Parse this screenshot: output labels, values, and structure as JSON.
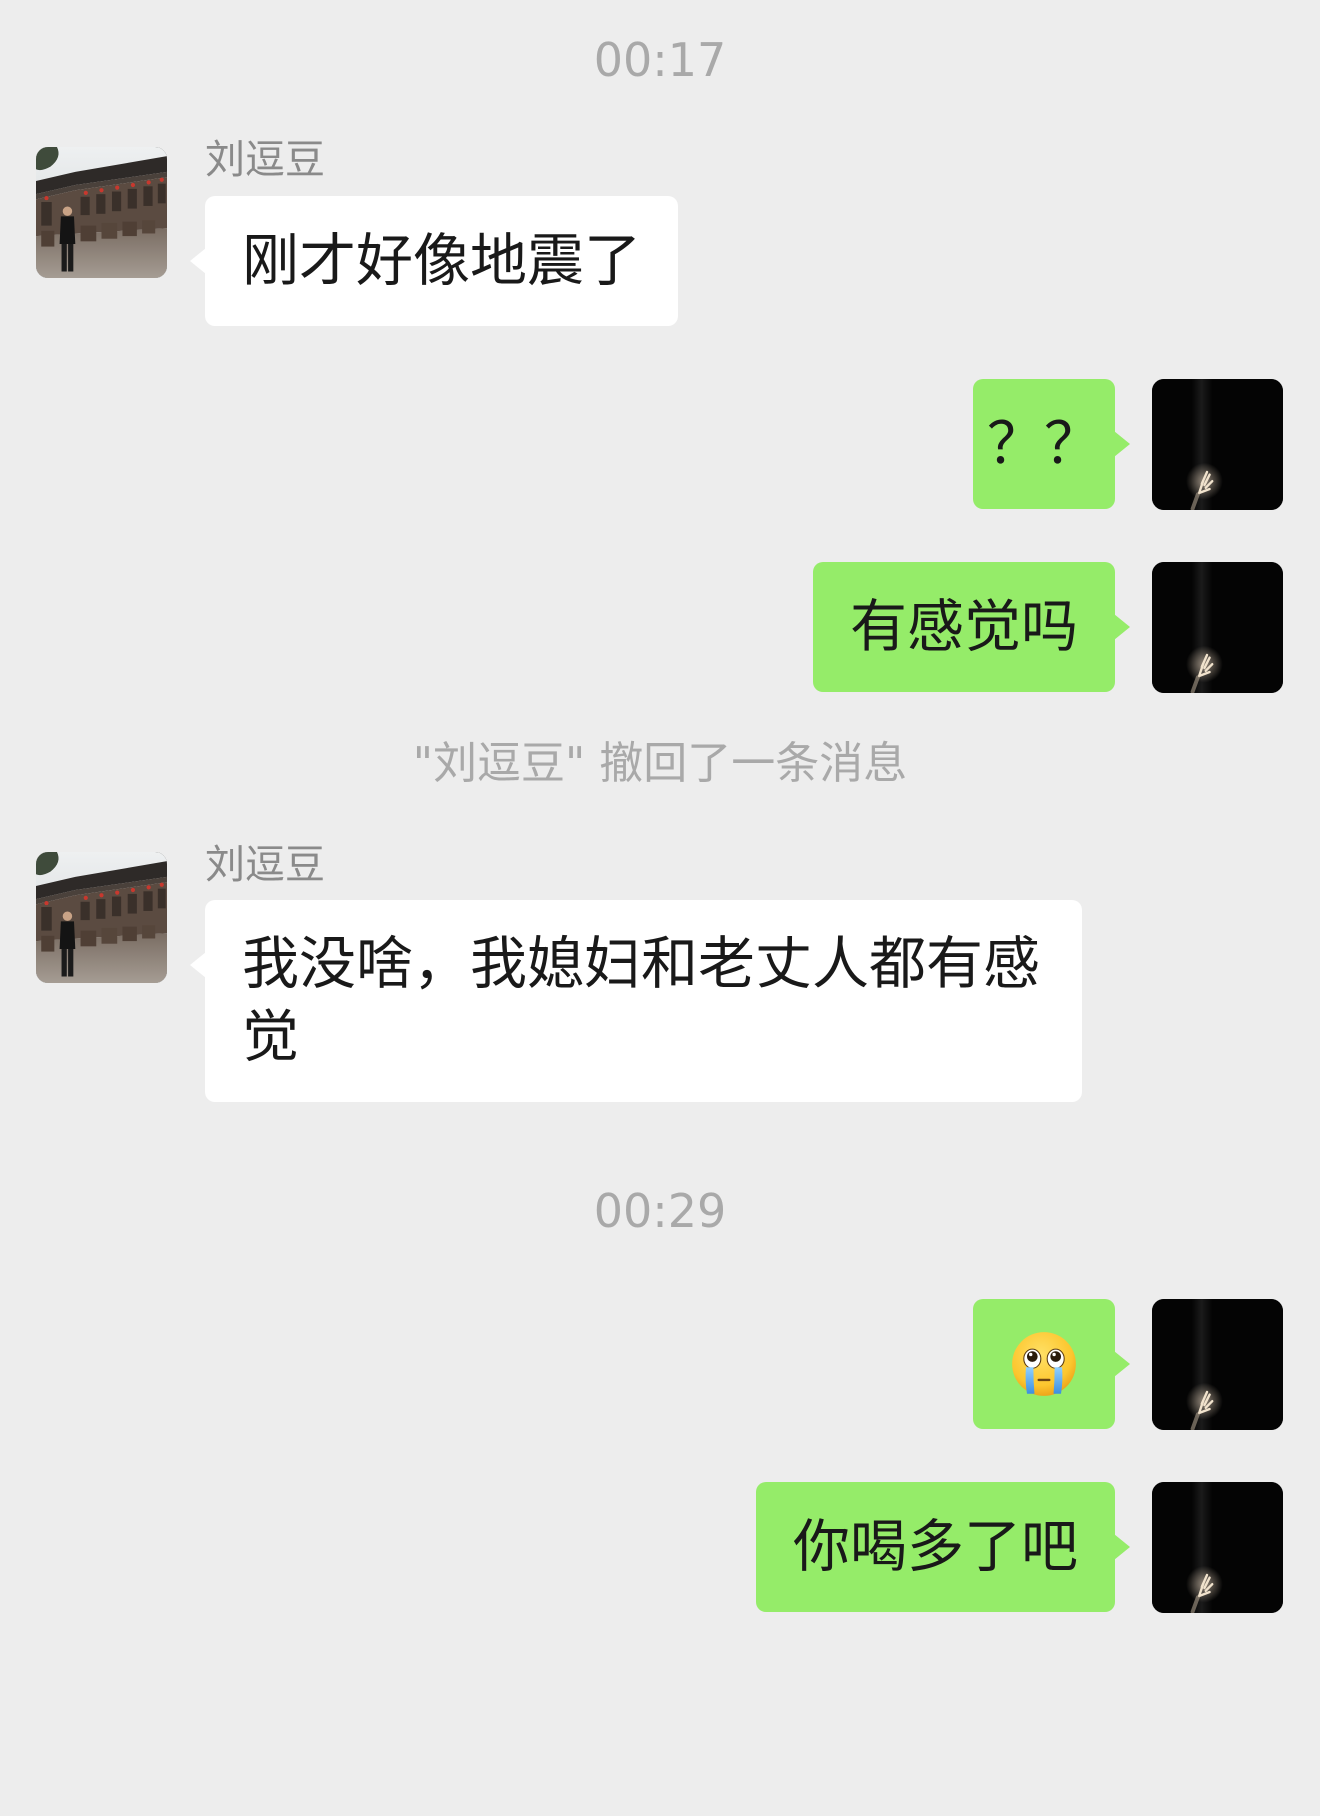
{
  "theme": {
    "background": "#ededed",
    "incoming_bubble": "#ffffff",
    "outgoing_bubble": "#95ec69",
    "meta_text": "#a9a9a9",
    "sender_name": "#8a8a8a"
  },
  "chat": [
    {
      "timestamp": "00:17"
    },
    {
      "sender": "刘逗豆",
      "text": "刚才好像地震了",
      "avatar_icon": "contact-avatar-photo"
    },
    {
      "text": "？？",
      "avatar_icon": "self-avatar-dark-hand"
    },
    {
      "text": "有感觉吗",
      "avatar_icon": "self-avatar-dark-hand"
    },
    {
      "system_notice": "\"刘逗豆\" 撤回了一条消息"
    },
    {
      "sender": "刘逗豆",
      "text": "我没啥，我媳妇和老丈人都有感觉",
      "avatar_icon": "contact-avatar-photo"
    },
    {
      "timestamp": "00:29"
    },
    {
      "emoji_icon": "crying-tears-emoji",
      "avatar_icon": "self-avatar-dark-hand"
    },
    {
      "text": "你喝多了吧",
      "avatar_icon": "self-avatar-dark-hand"
    }
  ]
}
